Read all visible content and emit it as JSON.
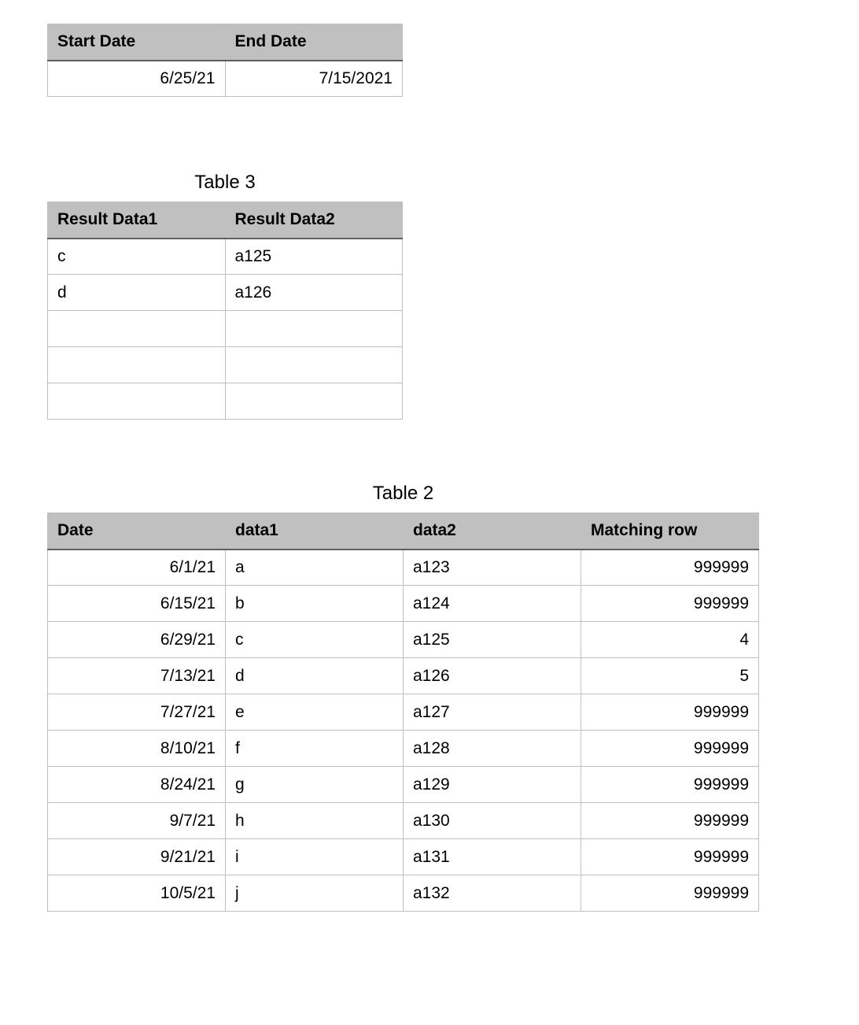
{
  "table1": {
    "headers": [
      "Start Date",
      "End Date"
    ],
    "rows": [
      [
        "6/25/21",
        "7/15/2021"
      ]
    ]
  },
  "table3": {
    "title": "Table 3",
    "headers": [
      "Result Data1",
      "Result Data2"
    ],
    "rows": [
      [
        "c",
        "a125"
      ],
      [
        "d",
        "a126"
      ],
      [
        "",
        ""
      ],
      [
        "",
        ""
      ],
      [
        "",
        ""
      ]
    ]
  },
  "table2": {
    "title": "Table 2",
    "headers": [
      "Date",
      "data1",
      "data2",
      "Matching row"
    ],
    "rows": [
      [
        "6/1/21",
        "a",
        "a123",
        "999999"
      ],
      [
        "6/15/21",
        "b",
        "a124",
        "999999"
      ],
      [
        "6/29/21",
        "c",
        "a125",
        "4"
      ],
      [
        "7/13/21",
        "d",
        "a126",
        "5"
      ],
      [
        "7/27/21",
        "e",
        "a127",
        "999999"
      ],
      [
        "8/10/21",
        "f",
        "a128",
        "999999"
      ],
      [
        "8/24/21",
        "g",
        "a129",
        "999999"
      ],
      [
        "9/7/21",
        "h",
        "a130",
        "999999"
      ],
      [
        "9/21/21",
        "i",
        "a131",
        "999999"
      ],
      [
        "10/5/21",
        "j",
        "a132",
        "999999"
      ]
    ]
  }
}
